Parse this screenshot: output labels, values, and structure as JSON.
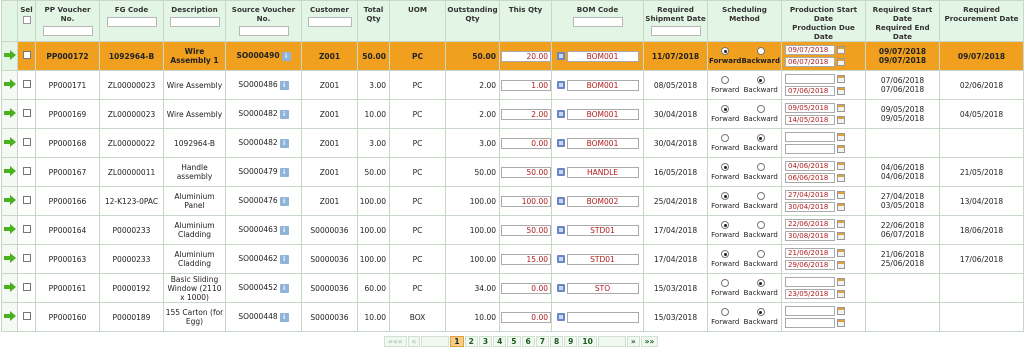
{
  "headers": {
    "sel": "Sel",
    "pp_voucher": "PP Voucher No.",
    "fg_code": "FG Code",
    "description": "Description",
    "source_voucher": "Source Voucher No.",
    "customer": "Customer",
    "total_qty": "Total Qty",
    "uom": "UOM",
    "outstanding_qty": "Outstanding Qty",
    "this_qty": "This Qty",
    "bom_code": "BOM Code",
    "required_shipment": "Required Shipment Date",
    "scheduling": "Scheduling Method",
    "prod_dates_1": "Production Start Date",
    "prod_dates_2": "Production Due Date",
    "req_dates_1": "Required Start Date",
    "req_dates_2": "Required End Date",
    "req_procurement": "Required Procurement Date"
  },
  "radio_labels": {
    "forward": "Forward",
    "backward": "Backward"
  },
  "info_glyph": "i",
  "rows": [
    {
      "pp": "PP000172",
      "fg": "1092964-B",
      "desc": "Wire Assembly 1",
      "src": "SO000490",
      "cust": "Z001",
      "total": "50.00",
      "uom": "PC",
      "out": "50.00",
      "this": "20.00",
      "bom": "BOM001",
      "ship": "11/07/2018",
      "fwd": true,
      "start": "09/07/2018",
      "due": "06/07/2018",
      "rs": "09/07/2018",
      "re": "09/07/2018",
      "proc": "09/07/2018"
    },
    {
      "pp": "PP000171",
      "fg": "ZL00000023",
      "desc": "Wire Assembly",
      "src": "SO000486",
      "cust": "Z001",
      "total": "3.00",
      "uom": "PC",
      "out": "2.00",
      "this": "1.00",
      "bom": "BOM001",
      "ship": "08/05/2018",
      "fwd": false,
      "start": "",
      "due": "07/06/2018",
      "rs": "07/06/2018",
      "re": "07/06/2018",
      "proc": "02/06/2018"
    },
    {
      "pp": "PP000169",
      "fg": "ZL00000023",
      "desc": "Wire Assembly",
      "src": "SO000482",
      "cust": "Z001",
      "total": "10.00",
      "uom": "PC",
      "out": "2.00",
      "this": "2.00",
      "bom": "BOM001",
      "ship": "30/04/2018",
      "fwd": true,
      "start": "09/05/2018",
      "due": "14/05/2018",
      "rs": "09/05/2018",
      "re": "09/05/2018",
      "proc": "04/05/2018"
    },
    {
      "pp": "PP000168",
      "fg": "ZL00000022",
      "desc": "1092964-B",
      "src": "SO000482",
      "cust": "Z001",
      "total": "3.00",
      "uom": "PC",
      "out": "3.00",
      "this": "0.00",
      "bom": "BOM001",
      "ship": "30/04/2018",
      "fwd": false,
      "start": "",
      "due": "",
      "rs": "",
      "re": "",
      "proc": ""
    },
    {
      "pp": "PP000167",
      "fg": "ZL00000011",
      "desc": "Handle assembly",
      "src": "SO000479",
      "cust": "Z001",
      "total": "50.00",
      "uom": "PC",
      "out": "50.00",
      "this": "50.00",
      "bom": "HANDLE",
      "ship": "16/05/2018",
      "fwd": true,
      "start": "04/06/2018",
      "due": "06/06/2018",
      "rs": "04/06/2018",
      "re": "04/06/2018",
      "proc": "21/05/2018"
    },
    {
      "pp": "PP000166",
      "fg": "12-K123-0PAC",
      "desc": "Aluminium Panel",
      "src": "SO000476",
      "cust": "Z001",
      "total": "100.00",
      "uom": "PC",
      "out": "100.00",
      "this": "100.00",
      "bom": "BOM002",
      "ship": "25/04/2018",
      "fwd": true,
      "start": "27/04/2018",
      "due": "30/04/2018",
      "rs": "27/04/2018",
      "re": "03/05/2018",
      "proc": "13/04/2018"
    },
    {
      "pp": "PP000164",
      "fg": "P0000233",
      "desc": "Aluminium Cladding",
      "src": "SO000463",
      "cust": "S0000036",
      "total": "100.00",
      "uom": "PC",
      "out": "100.00",
      "this": "50.00",
      "bom": "STD01",
      "ship": "17/04/2018",
      "fwd": true,
      "start": "22/06/2018",
      "due": "30/08/2018",
      "rs": "22/06/2018",
      "re": "06/07/2018",
      "proc": "18/06/2018"
    },
    {
      "pp": "PP000163",
      "fg": "P0000233",
      "desc": "Aluminium Cladding",
      "src": "SO000462",
      "cust": "S0000036",
      "total": "100.00",
      "uom": "PC",
      "out": "100.00",
      "this": "15.00",
      "bom": "STD01",
      "ship": "17/04/2018",
      "fwd": true,
      "start": "21/06/2018",
      "due": "29/06/2018",
      "rs": "21/06/2018",
      "re": "25/06/2018",
      "proc": "17/06/2018"
    },
    {
      "pp": "PP000161",
      "fg": "P0000192",
      "desc": "Basic Sliding Window (2110 x 1000)",
      "src": "SO000452",
      "cust": "S0000036",
      "total": "60.00",
      "uom": "PC",
      "out": "34.00",
      "this": "0.00",
      "bom": "STO",
      "ship": "15/03/2018",
      "fwd": false,
      "start": "",
      "due": "23/05/2018",
      "rs": "",
      "re": "",
      "proc": ""
    },
    {
      "pp": "PP000160",
      "fg": "P0000189",
      "desc": "155 Carton (for Egg)",
      "src": "SO000448",
      "cust": "S0000036",
      "total": "10.00",
      "uom": "BOX",
      "out": "10.00",
      "this": "0.00",
      "bom": "",
      "ship": "15/03/2018",
      "fwd": false,
      "start": "",
      "due": "",
      "rs": "",
      "re": "",
      "proc": ""
    }
  ],
  "pager": {
    "first": "«««",
    "prev": "«",
    "pages": [
      "1",
      "2",
      "3",
      "4",
      "5",
      "6",
      "7",
      "8",
      "9",
      "10"
    ],
    "current": "1",
    "next": "»",
    "last": "»»"
  }
}
